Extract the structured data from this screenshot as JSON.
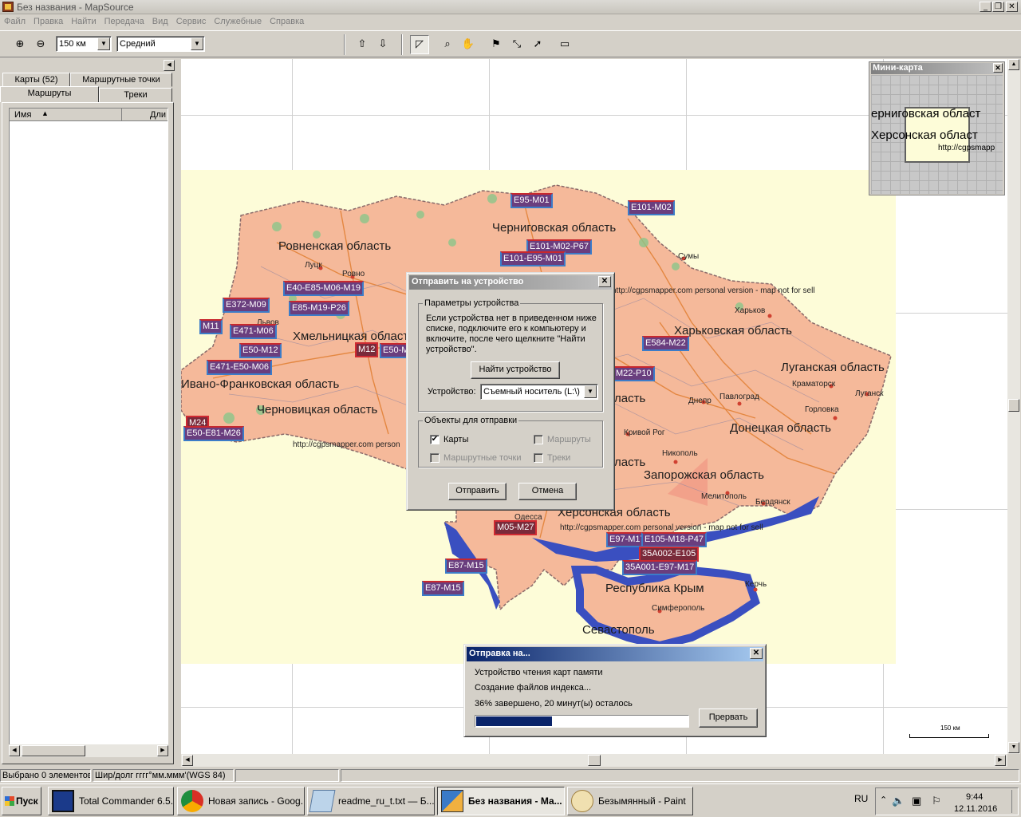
{
  "window": {
    "title": "Без названия - MapSource",
    "min": "_",
    "restore": "❐",
    "close": "✕"
  },
  "menu": [
    "Файл",
    "Правка",
    "Найти",
    "Передача",
    "Вид",
    "Сервис",
    "Служебные",
    "Справка"
  ],
  "toolbar": {
    "scale_value": "150 км",
    "detail_value": "Средний"
  },
  "left_panel": {
    "tabs_row1": [
      "Карты (52)",
      "Маршрутные точки"
    ],
    "tabs_row2": [
      "Маршруты",
      "Треки"
    ],
    "columns": [
      "Имя",
      "Дли"
    ]
  },
  "map": {
    "regions": [
      "Черниговская область",
      "Ровненская область",
      "Хмельницкая область",
      "Ивано-Франковская область",
      "Черновицкая область",
      "Харьковская область",
      "Луганская область",
      "Донецкая область",
      "Запорожская область",
      "Херсонская область",
      "Республика Крым",
      "Севастополь",
      "ласть",
      "ласть"
    ],
    "cities": [
      "Луцк",
      "Ровно",
      "Львов",
      "Сумы",
      "Харьков",
      "Краматорск",
      "Луганск",
      "Днепр",
      "Павлоград",
      "Горловка",
      "Кривой Рог",
      "Никополь",
      "Мелитополь",
      "Бердянск",
      "Симферополь",
      "Керчь",
      "Одесса"
    ],
    "watermarks": [
      "http://cgpsmapper.com personal version - map not for sell",
      "http://cgpsmapper.com person",
      "http://cgpsmapper.com personal version - map not for sell"
    ],
    "roads": [
      "E95-M01",
      "E101-M02",
      "E101-M02-P67",
      "E101-E95-M01",
      "E40-E85-M06-M19",
      "E85-M19-P26",
      "E372-M09",
      "M11",
      "E471-M06",
      "E50-M12",
      "M12",
      "E50-M",
      "E471-E50-M06",
      "M24",
      "E50-E81-M26",
      "E584-M22",
      "M22-P10",
      "M05-M27",
      "E97-M17",
      "E105-M18-P47",
      "35A002-E105",
      "35A001-E97-M17",
      "E87-M15",
      "E87-M15"
    ],
    "scale_label": "150 км"
  },
  "minimap": {
    "title": "Мини-карта",
    "label1": "ерниговская област",
    "label2": "Херсонская област",
    "label3": "http://cgpsmapp"
  },
  "send_dialog": {
    "title": "Отправить на устройство",
    "group1": "Параметры устройства",
    "info": "Если устройства нет в приведенном ниже списке, подключите его к компьютеру и включите, после чего щелкните \"Найти устройство\".",
    "find_button": "Найти устройство",
    "device_label": "Устройство:",
    "device_value": "Съемный носитель (L:\\)",
    "group2": "Объекты для отправки",
    "chk_maps": "Карты",
    "chk_routes": "Маршруты",
    "chk_waypoints": "Маршрутные точки",
    "chk_tracks": "Треки",
    "send_button": "Отправить",
    "cancel_button": "Отмена"
  },
  "progress_dialog": {
    "title": "Отправка на...",
    "line1": "Устройство чтения карт памяти",
    "line2": "Создание файлов индекса...",
    "line3": "36% завершено, 20 минут(ы) осталось",
    "progress": 0.36,
    "abort_button": "Прервать"
  },
  "status": {
    "selected": "Выбрано 0 элементов",
    "coords": "Шир/долг гггг°мм.ммм'(WGS 84)"
  },
  "taskbar": {
    "start": "Пуск",
    "tasks": [
      "Total Commander 6.5...",
      "Новая запись - Goog...",
      "readme_ru_t.txt — Б...",
      "Без названия - Ма...",
      "Безымянный - Paint"
    ],
    "lang": "RU",
    "time": "9:44",
    "date": "12.11.2016"
  },
  "colors": {
    "map_land": "#f5b99a",
    "map_sea": "#3a4fc0",
    "title_gradient_start": "#0a246a",
    "title_gradient_end": "#a6caf0",
    "progress_fill": "#0a246a"
  }
}
